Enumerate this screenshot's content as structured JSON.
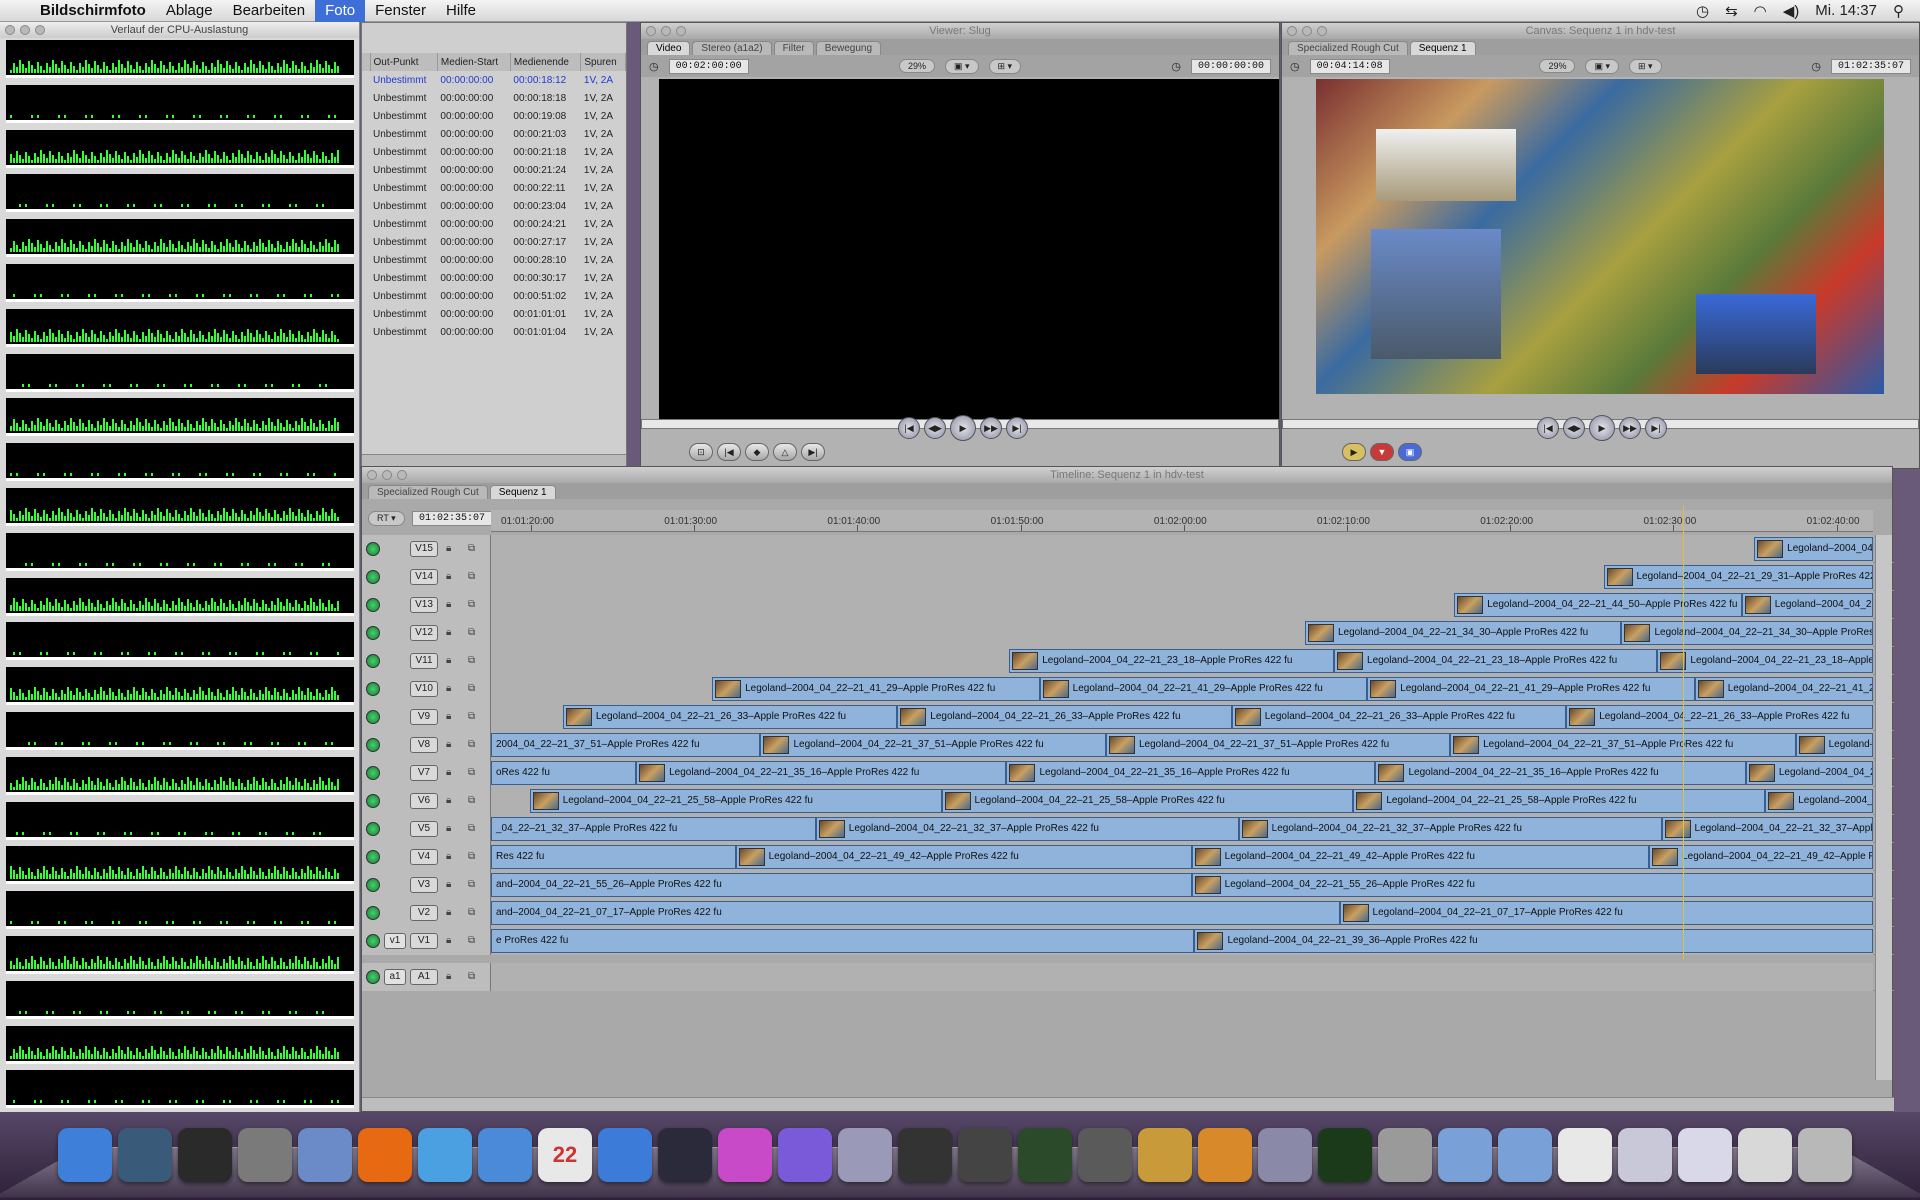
{
  "menubar": {
    "app_name": "Bildschirmfoto",
    "items": [
      "Ablage",
      "Bearbeiten",
      "Foto",
      "Fenster",
      "Hilfe"
    ],
    "clock": "Mi. 14:37"
  },
  "cpu_window": {
    "title": "Verlauf der CPU-Auslastung"
  },
  "browser": {
    "columns": [
      "Out-Punkt",
      "Medien-Start",
      "Medienende",
      "Spuren"
    ],
    "rows": [
      [
        "Unbestimmt",
        "00:00:00:00",
        "00:00:18:12",
        "1V, 2A"
      ],
      [
        "Unbestimmt",
        "00:00:00:00",
        "00:00:18:18",
        "1V, 2A"
      ],
      [
        "Unbestimmt",
        "00:00:00:00",
        "00:00:19:08",
        "1V, 2A"
      ],
      [
        "Unbestimmt",
        "00:00:00:00",
        "00:00:21:03",
        "1V, 2A"
      ],
      [
        "Unbestimmt",
        "00:00:00:00",
        "00:00:21:18",
        "1V, 2A"
      ],
      [
        "Unbestimmt",
        "00:00:00:00",
        "00:00:21:24",
        "1V, 2A"
      ],
      [
        "Unbestimmt",
        "00:00:00:00",
        "00:00:22:11",
        "1V, 2A"
      ],
      [
        "Unbestimmt",
        "00:00:00:00",
        "00:00:23:04",
        "1V, 2A"
      ],
      [
        "Unbestimmt",
        "00:00:00:00",
        "00:00:24:21",
        "1V, 2A"
      ],
      [
        "Unbestimmt",
        "00:00:00:00",
        "00:00:27:17",
        "1V, 2A"
      ],
      [
        "Unbestimmt",
        "00:00:00:00",
        "00:00:28:10",
        "1V, 2A"
      ],
      [
        "Unbestimmt",
        "00:00:00:00",
        "00:00:30:17",
        "1V, 2A"
      ],
      [
        "Unbestimmt",
        "00:00:00:00",
        "00:00:51:02",
        "1V, 2A"
      ],
      [
        "Unbestimmt",
        "00:00:00:00",
        "00:01:01:01",
        "1V, 2A"
      ],
      [
        "Unbestimmt",
        "00:00:00:00",
        "00:01:01:04",
        "1V, 2A"
      ]
    ]
  },
  "viewer": {
    "title": "Viewer: Slug",
    "tabs": [
      "Video",
      "Stereo (a1a2)",
      "Filter",
      "Bewegung"
    ],
    "timecode_left": "00:02:00:00",
    "timecode_right": "00:00:00:00",
    "zoom": "29%"
  },
  "canvas": {
    "title": "Canvas: Sequenz 1 in hdv-test",
    "tabs": [
      "Specialized Rough Cut",
      "Sequenz 1"
    ],
    "timecode_left": "00:04:14:08",
    "timecode_right": "01:02:35:07",
    "zoom": "29%"
  },
  "timeline": {
    "title": "Timeline: Sequenz 1 in hdv-test",
    "tabs": [
      "Specialized Rough Cut",
      "Sequenz 1"
    ],
    "rt_label": "RT",
    "current_timecode": "01:02:35:07",
    "ruler": [
      "01:01:20:00",
      "01:01:30:00",
      "01:01:40:00",
      "01:01:50:00",
      "01:02:00:00",
      "01:02:10:00",
      "01:02:20:00",
      "01:02:30:00",
      "01:02:40:00"
    ],
    "tracks": [
      {
        "label": "V15",
        "src": "",
        "clips": [
          {
            "text": "Legoland–2004_04_",
            "start": 0.914,
            "end": 1.0
          }
        ]
      },
      {
        "label": "V14",
        "src": "",
        "clips": [
          {
            "text": "Legoland–2004_04_22–21_29_31–Apple ProRes 422 fu",
            "start": 0.805,
            "end": 1.0
          }
        ]
      },
      {
        "label": "V13",
        "src": "",
        "clips": [
          {
            "text": "Legoland–2004_04_22–21_44_50–Apple ProRes 422 fu",
            "start": 0.697,
            "end": 0.905
          },
          {
            "text": "Legoland–2004_04_22",
            "start": 0.905,
            "end": 1.0
          }
        ]
      },
      {
        "label": "V12",
        "src": "",
        "clips": [
          {
            "text": "Legoland–2004_04_22–21_34_30–Apple ProRes 422 fu",
            "start": 0.589,
            "end": 0.818
          },
          {
            "text": "Legoland–2004_04_22–21_34_30–Apple ProRes 4",
            "start": 0.818,
            "end": 1.0
          }
        ]
      },
      {
        "label": "V11",
        "src": "",
        "clips": [
          {
            "text": "Legoland–2004_04_22–21_23_18–Apple ProRes 422 fu",
            "start": 0.375,
            "end": 0.61
          },
          {
            "text": "Legoland–2004_04_22–21_23_18–Apple ProRes 422 fu",
            "start": 0.61,
            "end": 0.844
          },
          {
            "text": "Legoland–2004_04_22–21_23_18–Apple ProRes 422 f",
            "start": 0.844,
            "end": 1.0
          }
        ]
      },
      {
        "label": "V10",
        "src": "",
        "clips": [
          {
            "text": "Legoland–2004_04_22–21_41_29–Apple ProRes 422 fu",
            "start": 0.16,
            "end": 0.397
          },
          {
            "text": "Legoland–2004_04_22–21_41_29–Apple ProRes 422 fu",
            "start": 0.397,
            "end": 0.634
          },
          {
            "text": "Legoland–2004_04_22–21_41_29–Apple ProRes 422 fu",
            "start": 0.634,
            "end": 0.871
          },
          {
            "text": "Legoland–2004_04_22–21_41_29",
            "start": 0.871,
            "end": 1.0
          }
        ]
      },
      {
        "label": "V9",
        "src": "",
        "clips": [
          {
            "text": "Legoland–2004_04_22–21_26_33–Apple ProRes 422 fu",
            "start": 0.052,
            "end": 0.294
          },
          {
            "text": "Legoland–2004_04_22–21_26_33–Apple ProRes 422 fu",
            "start": 0.294,
            "end": 0.536
          },
          {
            "text": "Legoland–2004_04_22–21_26_33–Apple ProRes 422 fu",
            "start": 0.536,
            "end": 0.778
          },
          {
            "text": "Legoland–2004_04_22–21_26_33–Apple ProRes 422 fu",
            "start": 0.778,
            "end": 1.0
          }
        ]
      },
      {
        "label": "V8",
        "src": "",
        "clips": [
          {
            "text": "2004_04_22–21_37_51–Apple ProRes 422 fu",
            "start": 0.0,
            "end": 0.195,
            "nothumb": true
          },
          {
            "text": "Legoland–2004_04_22–21_37_51–Apple ProRes 422 fu",
            "start": 0.195,
            "end": 0.445
          },
          {
            "text": "Legoland–2004_04_22–21_37_51–Apple ProRes 422 fu",
            "start": 0.445,
            "end": 0.694
          },
          {
            "text": "Legoland–2004_04_22–21_37_51–Apple ProRes 422 fu",
            "start": 0.694,
            "end": 0.944
          },
          {
            "text": "Legoland–",
            "start": 0.944,
            "end": 1.0
          }
        ]
      },
      {
        "label": "V7",
        "src": "",
        "clips": [
          {
            "text": "oRes 422 fu",
            "start": 0.0,
            "end": 0.105,
            "nothumb": true
          },
          {
            "text": "Legoland–2004_04_22–21_35_16–Apple ProRes 422 fu",
            "start": 0.105,
            "end": 0.373
          },
          {
            "text": "Legoland–2004_04_22–21_35_16–Apple ProRes 422 fu",
            "start": 0.373,
            "end": 0.64
          },
          {
            "text": "Legoland–2004_04_22–21_35_16–Apple ProRes 422 fu",
            "start": 0.64,
            "end": 0.908
          },
          {
            "text": "Legoland–2004_04_2",
            "start": 0.908,
            "end": 1.0
          }
        ]
      },
      {
        "label": "V6",
        "src": "",
        "clips": [
          {
            "text": "Legoland–2004_04_22–21_25_58–Apple ProRes 422 fu",
            "start": 0.028,
            "end": 0.326
          },
          {
            "text": "Legoland–2004_04_22–21_25_58–Apple ProRes 422 fu",
            "start": 0.326,
            "end": 0.624
          },
          {
            "text": "Legoland–2004_04_22–21_25_58–Apple ProRes 422 fu",
            "start": 0.624,
            "end": 0.922
          },
          {
            "text": "Legoland–2004_0",
            "start": 0.922,
            "end": 1.0
          }
        ]
      },
      {
        "label": "V5",
        "src": "",
        "clips": [
          {
            "text": "_04_22–21_32_37–Apple ProRes 422 fu",
            "start": 0.0,
            "end": 0.235,
            "nothumb": true
          },
          {
            "text": "Legoland–2004_04_22–21_32_37–Apple ProRes 422 fu",
            "start": 0.235,
            "end": 0.541
          },
          {
            "text": "Legoland–2004_04_22–21_32_37–Apple ProRes 422 fu",
            "start": 0.541,
            "end": 0.847
          },
          {
            "text": "Legoland–2004_04_22–21_32_37–Apple",
            "start": 0.847,
            "end": 1.0
          }
        ]
      },
      {
        "label": "V4",
        "src": "",
        "clips": [
          {
            "text": "Res 422 fu",
            "start": 0.0,
            "end": 0.177,
            "nothumb": true
          },
          {
            "text": "Legoland–2004_04_22–21_49_42–Apple ProRes 422 fu",
            "start": 0.177,
            "end": 0.507
          },
          {
            "text": "Legoland–2004_04_22–21_49_42–Apple ProRes 422 fu",
            "start": 0.507,
            "end": 0.838
          },
          {
            "text": "Legoland–2004_04_22–21_49_42–Apple Pro",
            "start": 0.838,
            "end": 1.0
          }
        ]
      },
      {
        "label": "V3",
        "src": "",
        "clips": [
          {
            "text": "and–2004_04_22–21_55_26–Apple ProRes 422 fu",
            "start": 0.0,
            "end": 0.507,
            "nothumb": true
          },
          {
            "text": "Legoland–2004_04_22–21_55_26–Apple ProRes 422 fu",
            "start": 0.507,
            "end": 1.0
          }
        ]
      },
      {
        "label": "V2",
        "src": "",
        "clips": [
          {
            "text": "and–2004_04_22–21_07_17–Apple ProRes 422 fu",
            "start": 0.0,
            "end": 0.614,
            "nothumb": true
          },
          {
            "text": "Legoland–2004_04_22–21_07_17–Apple ProRes 422 fu",
            "start": 0.614,
            "end": 1.0
          }
        ]
      },
      {
        "label": "V1",
        "src": "v1",
        "clips": [
          {
            "text": "e ProRes 422 fu",
            "start": 0.0,
            "end": 0.509,
            "nothumb": true
          },
          {
            "text": "Legoland–2004_04_22–21_39_36–Apple ProRes 422 fu",
            "start": 0.509,
            "end": 1.0
          }
        ]
      },
      {
        "label": "A1",
        "src": "a1",
        "clips": []
      }
    ]
  },
  "dock": {
    "items": [
      {
        "name": "finder-icon",
        "color": "#3d7fd9"
      },
      {
        "name": "time-machine-icon",
        "color": "#3a5a7a"
      },
      {
        "name": "dashboard-icon",
        "color": "#2a2a2a"
      },
      {
        "name": "system-preferences-icon",
        "color": "#7a7a7a"
      },
      {
        "name": "mail-icon",
        "color": "#6a8ac8"
      },
      {
        "name": "firefox-icon",
        "color": "#e76a12"
      },
      {
        "name": "safari-icon",
        "color": "#4aa0e0"
      },
      {
        "name": "ichat-icon",
        "color": "#4a8ad8"
      },
      {
        "name": "ical-icon",
        "color": "#e8e8e8",
        "text": "22"
      },
      {
        "name": "itunes-icon",
        "color": "#3c7cd8"
      },
      {
        "name": "aperture-icon",
        "color": "#2a2a3a"
      },
      {
        "name": "color-icon",
        "color": "#c84ac8"
      },
      {
        "name": "motion-icon",
        "color": "#7a5ad8"
      },
      {
        "name": "dvd-studio-icon",
        "color": "#9a9ab8"
      },
      {
        "name": "final-cut-icon",
        "color": "#333"
      },
      {
        "name": "clapper-icon",
        "color": "#444"
      },
      {
        "name": "soundtrack-icon",
        "color": "#2a4a2a"
      },
      {
        "name": "compressor-icon",
        "color": "#5a5a5a"
      },
      {
        "name": "logic-icon",
        "color": "#c89a3a"
      },
      {
        "name": "shake-icon",
        "color": "#d88a2a"
      },
      {
        "name": "preview-icon",
        "color": "#8a8aa8"
      },
      {
        "name": "activity-monitor-icon",
        "color": "#1a3a1a"
      },
      {
        "name": "grab-icon",
        "color": "#9a9a9a"
      },
      {
        "name": "applications-folder-icon",
        "color": "#7aa0d8"
      },
      {
        "name": "documents-folder-icon",
        "color": "#7aa0d8"
      },
      {
        "name": "downloads-stack-icon",
        "color": "#e8e8e8"
      },
      {
        "name": "stack-icon",
        "color": "#c8c8d8"
      },
      {
        "name": "stack2-icon",
        "color": "#d8d8e8"
      },
      {
        "name": "stack3-icon",
        "color": "#d8d8d8"
      },
      {
        "name": "trash-icon",
        "color": "#b8b8b8"
      }
    ]
  }
}
